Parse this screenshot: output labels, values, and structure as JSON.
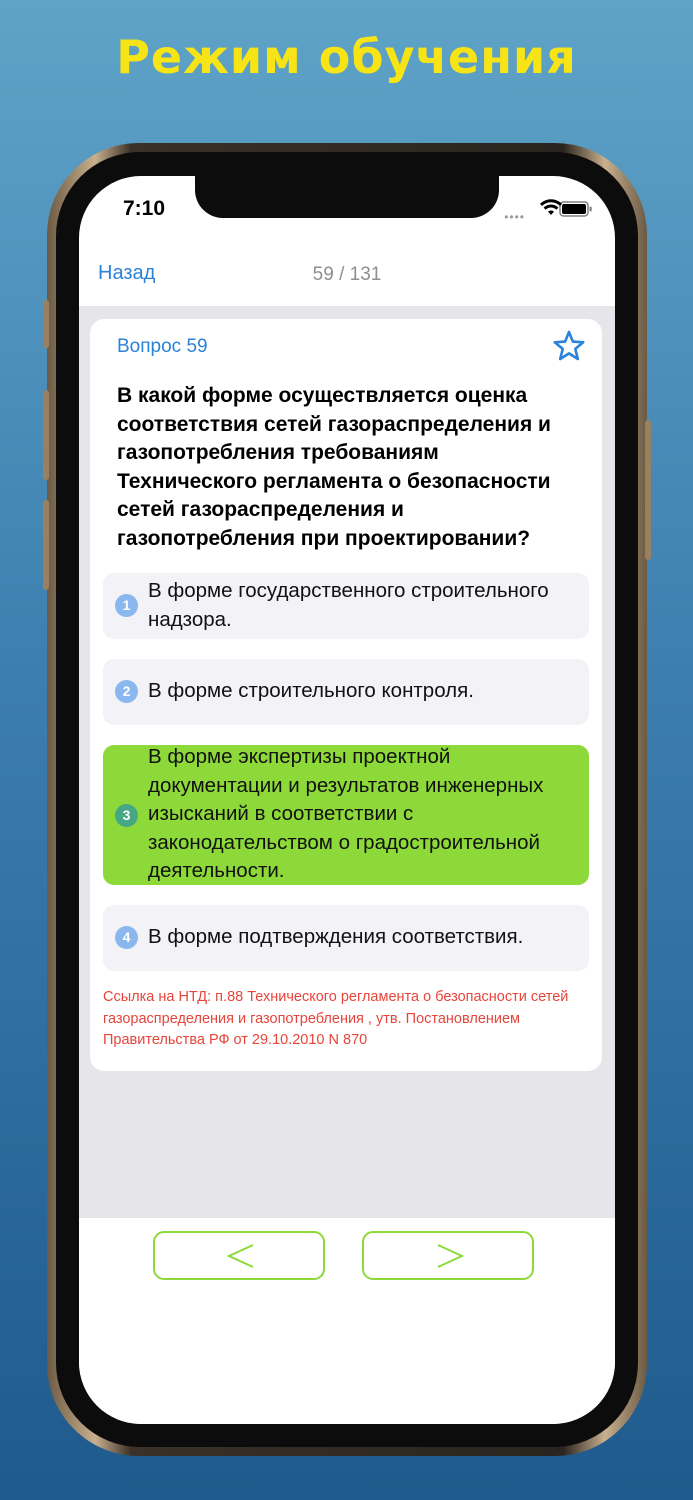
{
  "headline": "Режим обучения",
  "status_bar": {
    "time": "7:10"
  },
  "nav": {
    "back_label": "Назад",
    "counter": "59 / 131"
  },
  "question": {
    "label": "Вопрос 59",
    "text": "В какой форме осуществляется оценка соответствия сетей газораспределения и газопотребления требованиям Технического регламента о безопасности сетей газораспределения и газопотребления при проектировании?"
  },
  "answers": [
    {
      "number": "1",
      "text": "В форме государственного строительного надзора.",
      "correct": false
    },
    {
      "number": "2",
      "text": "В форме строительного контроля.",
      "correct": false
    },
    {
      "number": "3",
      "text": "В форме экспертизы проектной документации и результатов инженерных изысканий в соответствии с законодательством о градостроительной деятельности.",
      "correct": true
    },
    {
      "number": "4",
      "text": "В форме подтверждения соответствия.",
      "correct": false
    }
  ],
  "reference": " Ссылка на НТД: п.88 Технического регламента о безопасности сетей газораспределения и газопотребления , утв. Постановлением Правительства РФ от 29.10.2010 N 870",
  "colors": {
    "accent_blue": "#2b82d9",
    "correct_green": "#8ed93a",
    "reference_red": "#e8443a",
    "headline_yellow": "#f7e416"
  },
  "icons": {
    "favorite": "star-outline-icon",
    "prev": "chevron-left-icon",
    "next": "chevron-right-icon"
  }
}
